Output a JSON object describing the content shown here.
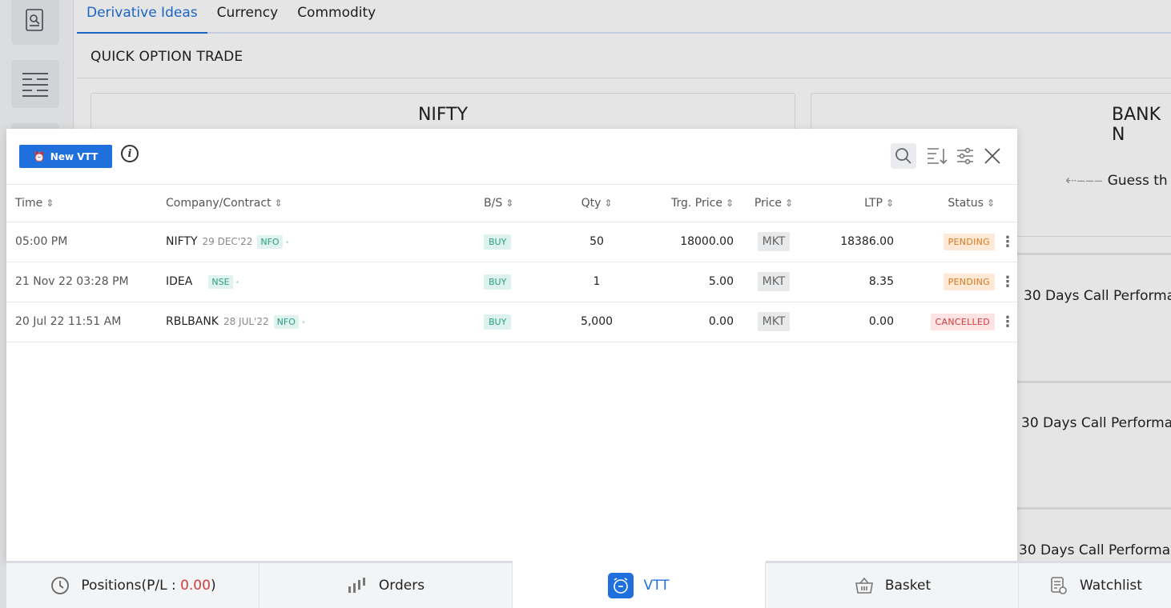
{
  "tabs": [
    {
      "label": "Derivative Ideas",
      "active": true
    },
    {
      "label": "Currency",
      "active": false
    },
    {
      "label": "Commodity",
      "active": false
    }
  ],
  "section_title": "QUICK OPTION TRADE",
  "cards": [
    {
      "title": "NIFTY"
    },
    {
      "title": "BANK N"
    }
  ],
  "guess_text": "Guess th",
  "performance_texts": [
    "30 Days Call Performa",
    "30 Days Call Performa",
    "30 Days Call Performa"
  ],
  "modal": {
    "new_vtt_label": "New VTT",
    "icons": {
      "info": "info-icon",
      "search": "search-icon",
      "sort": "sort-icon",
      "filter": "filter-icon",
      "close": "close-icon"
    },
    "columns": {
      "time": "Time",
      "company": "Company/Contract",
      "bs": "B/S",
      "qty": "Qty",
      "trg_price": "Trg. Price",
      "price": "Price",
      "ltp": "LTP",
      "status": "Status"
    },
    "rows": [
      {
        "time": "05:00 PM",
        "name": "NIFTY",
        "date": "29 DEC'22",
        "exchange": "NFO",
        "bs": "BUY",
        "qty": "50",
        "trg_price": "18000.00",
        "price": "MKT",
        "ltp": "18386.00",
        "status": "PENDING"
      },
      {
        "time": "21 Nov 22 03:28 PM",
        "name": "IDEA",
        "date": "",
        "exchange": "NSE",
        "bs": "BUY",
        "qty": "1",
        "trg_price": "5.00",
        "price": "MKT",
        "ltp": "8.35",
        "status": "PENDING"
      },
      {
        "time": "20 Jul 22 11:51 AM",
        "name": "RBLBANK",
        "date": "28 JUL'22",
        "exchange": "NFO",
        "bs": "BUY",
        "qty": "5,000",
        "trg_price": "0.00",
        "price": "MKT",
        "ltp": "0.00",
        "status": "CANCELLED"
      }
    ]
  },
  "bottom_bar": {
    "positions_label": "Positions(P/L : ",
    "positions_value": "0.00",
    "positions_close": ")",
    "orders_label": "Orders",
    "vtt_label": "VTT",
    "basket_label": "Basket",
    "watchlist_label": "Watchlist"
  },
  "colors": {
    "accent": "#1f6fdc",
    "pending": "#d9781d",
    "cancelled": "#d43b3b",
    "buy": "#2a9d82"
  }
}
